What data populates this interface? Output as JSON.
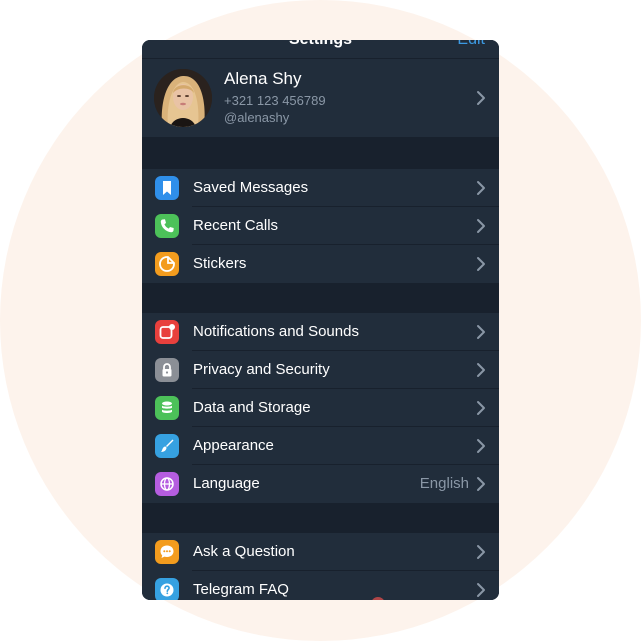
{
  "header": {
    "title": "Settings",
    "edit_label": "Edit"
  },
  "profile": {
    "name": "Alena Shy",
    "phone": "+321 123 456789",
    "username": "@alenashy"
  },
  "groups": [
    {
      "items": [
        {
          "label": "Saved Messages",
          "icon": "bookmark-icon",
          "color": "#2f8fea"
        },
        {
          "label": "Recent Calls",
          "icon": "phone-icon",
          "color": "#4cc159"
        },
        {
          "label": "Stickers",
          "icon": "sticker-icon",
          "color": "#f39c1e"
        }
      ]
    },
    {
      "items": [
        {
          "label": "Notifications and Sounds",
          "icon": "notifications-icon",
          "color": "#e8403d"
        },
        {
          "label": "Privacy and Security",
          "icon": "lock-icon",
          "color": "#8b8f96"
        },
        {
          "label": "Data and Storage",
          "icon": "database-icon",
          "color": "#4cc159"
        },
        {
          "label": "Appearance",
          "icon": "brush-icon",
          "color": "#36a1e1"
        },
        {
          "label": "Language",
          "icon": "globe-icon",
          "color": "#b55de0",
          "value": "English"
        }
      ]
    },
    {
      "items": [
        {
          "label": "Ask a Question",
          "icon": "chat-icon",
          "color": "#f39c1e"
        },
        {
          "label": "Telegram FAQ",
          "icon": "question-icon",
          "color": "#36a1e1"
        }
      ]
    }
  ]
}
